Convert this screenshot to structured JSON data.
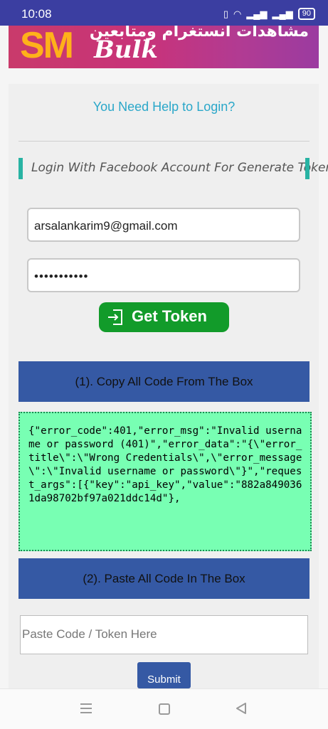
{
  "status_bar": {
    "time": "10:08",
    "battery": "90"
  },
  "banner": {
    "logo_sm": "SM",
    "logo_bulk": "Bulk",
    "arabic_text": "مشاهدات انستغرام ومتابعين"
  },
  "help_link": "You Need Help to Login?",
  "section_title": "Login With Facebook Account For Generate Token",
  "login": {
    "email_value": "arsalankarim9@gmail.com",
    "password_mask": "•••••••••••",
    "get_token_label": "Get Token"
  },
  "step1": {
    "label": "(1). Copy All Code From The Box"
  },
  "code_box_text": "{\"error_code\":401,\"error_msg\":\"Invalid username or password (401)\",\"error_data\":\"{\\\"error_title\\\":\\\"Wrong Credentials\\\",\\\"error_message\\\":\\\"Invalid username or password\\\"}\",\"request_args\":[{\"key\":\"api_key\",\"value\":\"882a8490361da98702bf97a021ddc14d\"},",
  "step2": {
    "label": "(2). Paste All Code In The Box"
  },
  "paste": {
    "placeholder": "Paste Code / Token Here"
  },
  "submit_label": "Submit",
  "colors": {
    "status_bar": "#3b3ea1",
    "step_bar": "#3559a4",
    "get_token": "#129b2a",
    "code_box": "#78ffb3",
    "accent": "#28b3a3",
    "help_link": "#2aa7c9"
  },
  "icons": {
    "login": "login-icon",
    "nav_menu": "menu-icon",
    "nav_home": "home-icon",
    "nav_back": "back-icon"
  }
}
